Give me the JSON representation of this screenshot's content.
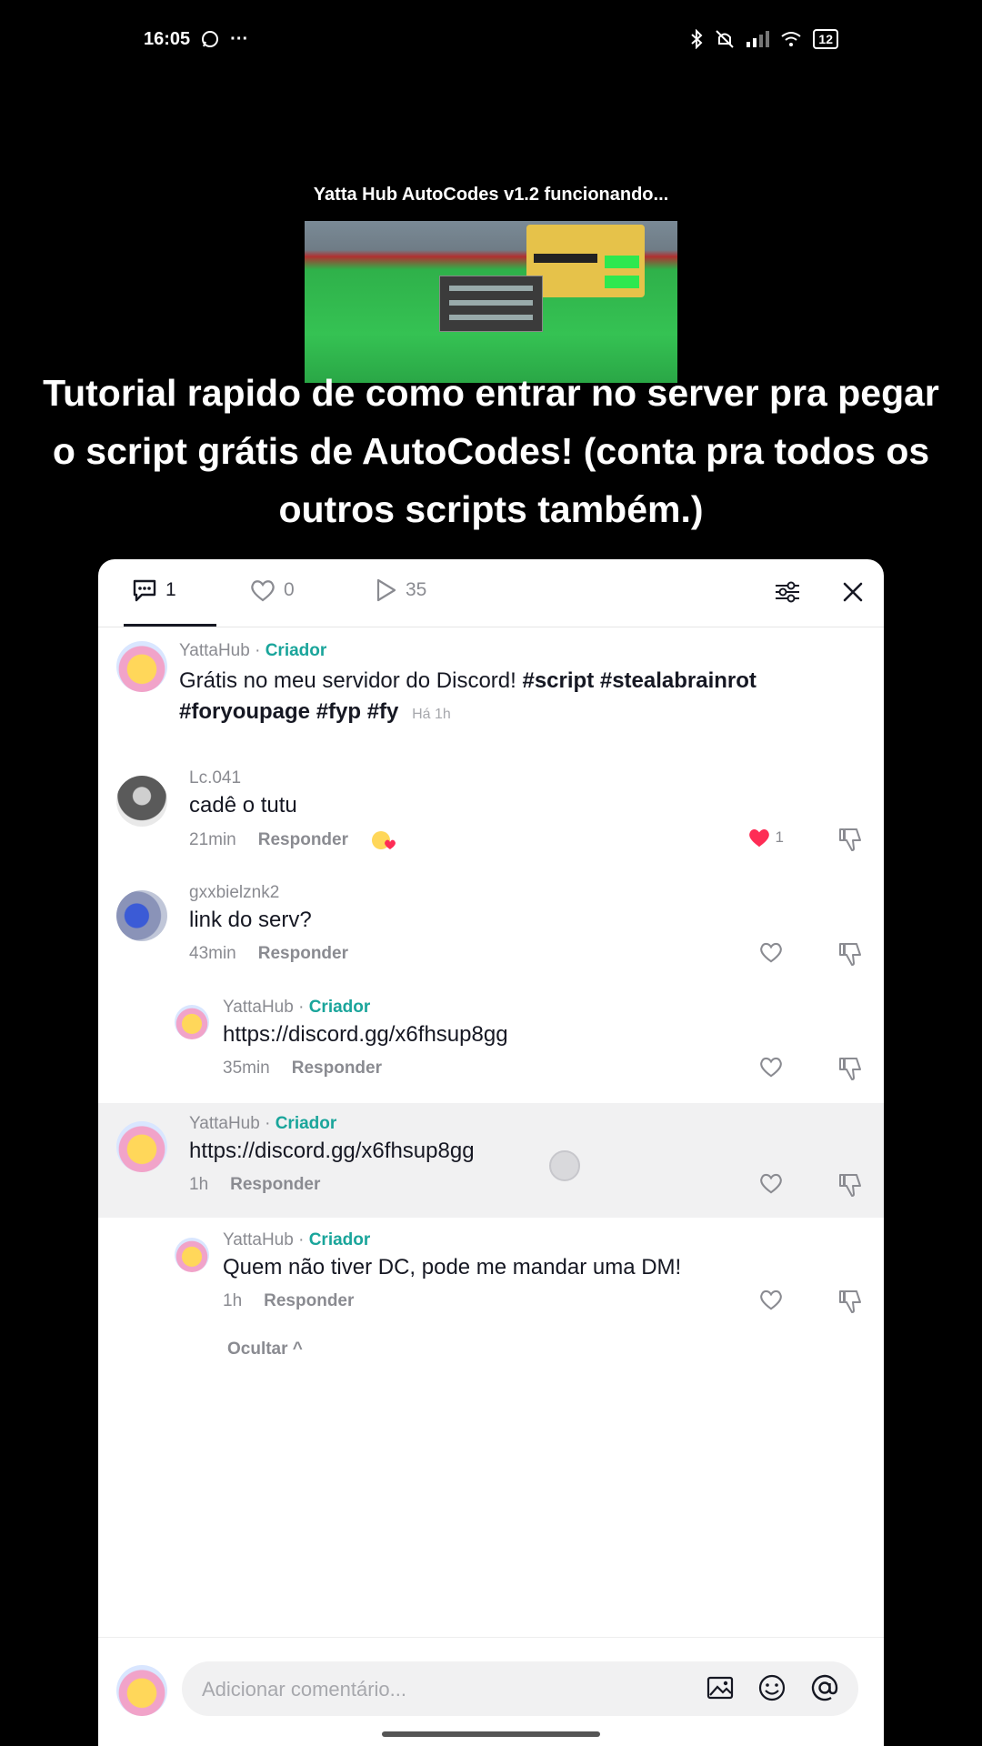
{
  "status_bar": {
    "time": "16:05",
    "battery": "12"
  },
  "video": {
    "title": "Yatta Hub AutoCodes v1.2 funcionando..."
  },
  "caption": "Tutorial rapido de como entrar no server pra pegar o script grátis de AutoCodes! (conta pra todos os outros scripts também.)",
  "header": {
    "comments_count": "1",
    "likes_count": "0",
    "views_count": "35"
  },
  "comments": [
    {
      "username": "YattaHub",
      "separator": " · ",
      "badge": "Criador",
      "text_line1_prefix": "Grátis no meu servidor do Discord! ",
      "text_line1_tags": "#script #stealabrainrot",
      "text_line2_tags": "#foryoupage #fyp #fy",
      "time": "Há 1h"
    },
    {
      "username": "Lc.041",
      "text": "cadê o tutu",
      "time": "21min",
      "reply": "Responder",
      "like_count": "1"
    },
    {
      "username": "gxxbielznk2",
      "text": "link do serv?",
      "time": "43min",
      "reply": "Responder"
    },
    {
      "username": "YattaHub",
      "separator": " · ",
      "badge": "Criador",
      "text": "https://discord.gg/x6fhsup8gg",
      "time": "35min",
      "reply": "Responder"
    },
    {
      "username": "YattaHub",
      "separator": " · ",
      "badge": "Criador",
      "text": "https://discord.gg/x6fhsup8gg",
      "time": "1h",
      "reply": "Responder"
    },
    {
      "username": "YattaHub",
      "separator": " · ",
      "badge": "Criador",
      "text": "Quem não tiver DC, pode me mandar uma DM!",
      "time": "1h",
      "reply": "Responder"
    }
  ],
  "hide_label": "Ocultar ^",
  "composer": {
    "placeholder": "Adicionar comentário..."
  },
  "colors": {
    "creator": "#1aa59b",
    "like_active": "#fe2c55",
    "highlight_row": "#f1f1f2"
  }
}
